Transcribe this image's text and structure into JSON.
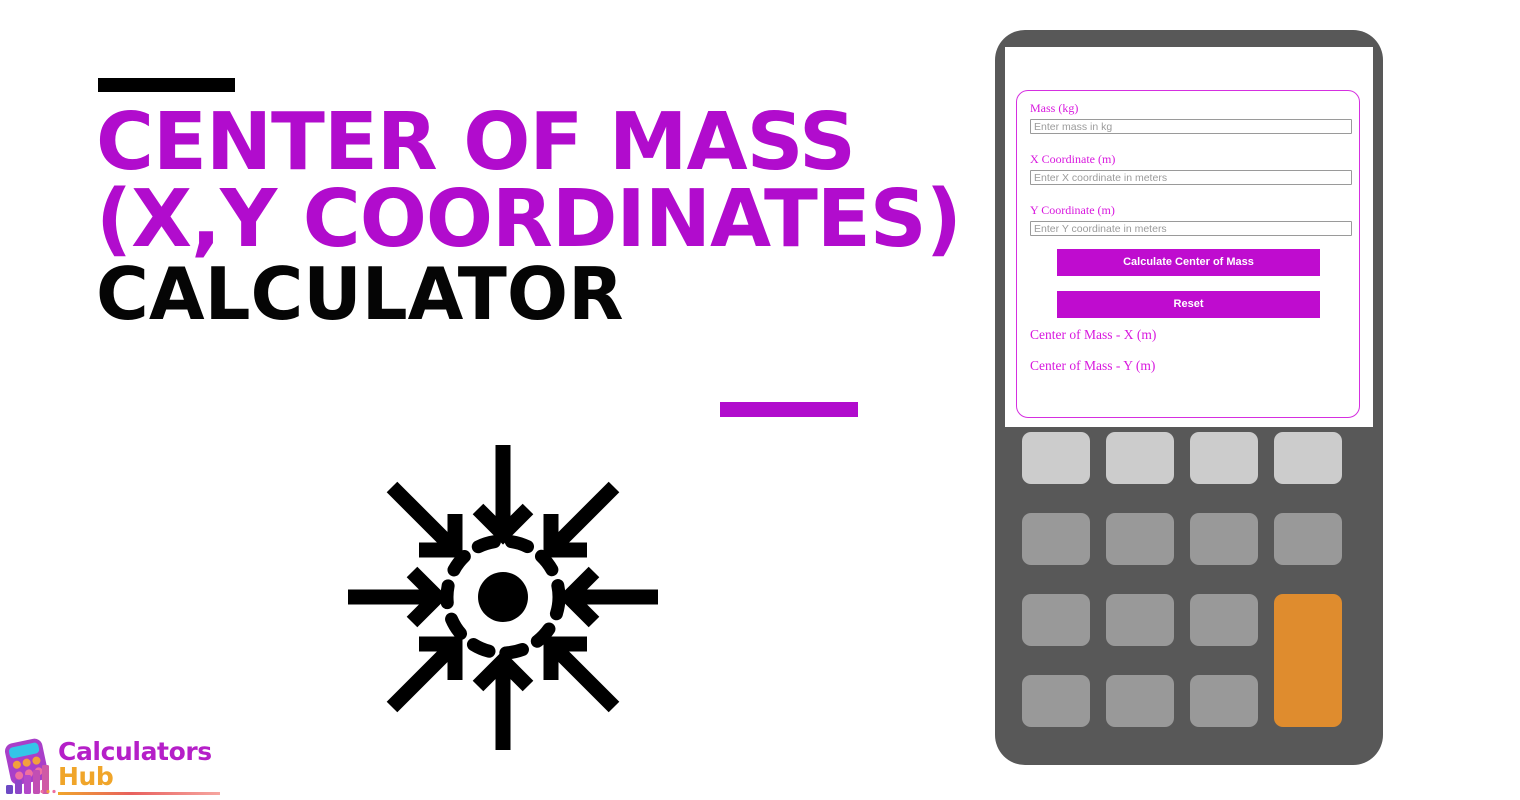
{
  "hero": {
    "title_lines": [
      "Center of Mass",
      "(X,Y Coordinates)",
      "Calculator"
    ],
    "accent_color": "#b10ccd",
    "dark_color": "#050505",
    "top_rule_color": "#000000",
    "bottom_rule_color": "#b10ccd",
    "icon_name": "center-of-mass-converging-arrows-icon"
  },
  "logo": {
    "word_primary": "Calculators",
    "word_secondary": "Hub",
    "primary_color": "#b51fc8",
    "secondary_color": "#f0a52a",
    "mark_name": "calculator-bar-chart-logo-mark"
  },
  "calculator": {
    "body_color": "#585858",
    "screen_color": "#ffffff",
    "card_border_color": "#d52fe0",
    "form": {
      "fields": [
        {
          "label": "Mass (kg)",
          "placeholder": "Enter mass in kg",
          "value": ""
        },
        {
          "label": "X Coordinate (m)",
          "placeholder": "Enter X coordinate in meters",
          "value": ""
        },
        {
          "label": "Y Coordinate (m)",
          "placeholder": "Enter Y coordinate in meters",
          "value": ""
        }
      ],
      "buttons": {
        "calculate_label": "Calculate Center of Mass",
        "reset_label": "Reset",
        "button_color": "#bf0ccf",
        "button_text_color": "#ffffff"
      },
      "results": [
        {
          "label": "Center of Mass - X (m)",
          "value": ""
        },
        {
          "label": "Center of Mass - Y (m)",
          "value": ""
        }
      ],
      "label_color": "#d817de"
    },
    "keypad": {
      "rows": 4,
      "cols": 4,
      "top_row_color": "#cccccc",
      "key_color": "#999999",
      "accent_key_color": "#df8c2e",
      "accent_key_position": "col-4-rows-3-4"
    }
  }
}
